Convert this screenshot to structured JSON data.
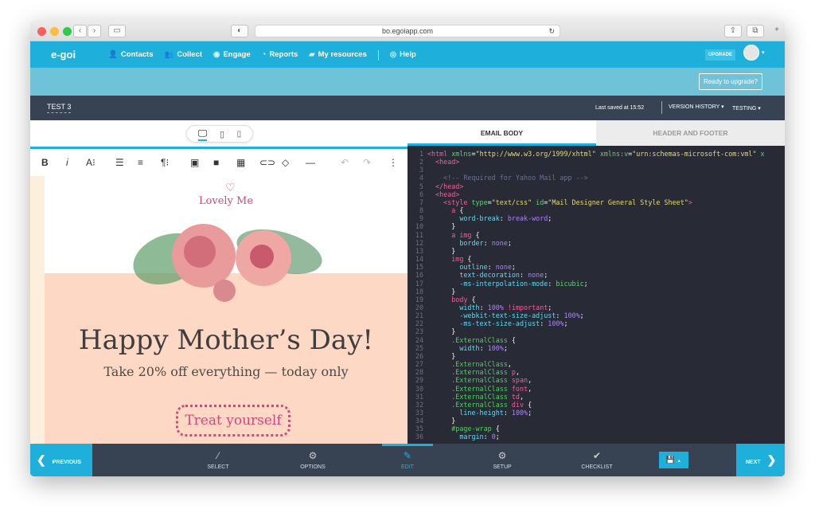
{
  "browser": {
    "url": "bo.egoiapp.com"
  },
  "nav": {
    "logo": "e-goi",
    "items": [
      {
        "icon": "contacts-icon",
        "glyph": "👤",
        "label": "Contacts"
      },
      {
        "icon": "collect-icon",
        "glyph": "👥",
        "label": "Collect"
      },
      {
        "icon": "engage-icon",
        "glyph": "◉",
        "label": "Engage"
      },
      {
        "icon": "reports-icon",
        "glyph": "◔",
        "label": "Reports"
      },
      {
        "icon": "folder-icon",
        "glyph": "▰",
        "label": "My resources"
      }
    ],
    "help": "Help",
    "upgrade": "UPGRADE"
  },
  "banner": {
    "ready": "Ready to upgrade?"
  },
  "editorbar": {
    "name": "TEST 3",
    "saved": "Last saved at 15:52",
    "version_history": "VERSION HISTORY ▾",
    "testing": "TESTING ▾"
  },
  "email": {
    "brand": "Lovely Me",
    "headline": "Happy Mother’s Day!",
    "subline": "Take 20% off everything — today only",
    "cta": "Treat yourself"
  },
  "tabs": {
    "email_body": "EMAIL BODY",
    "header_footer": "HEADER AND FOOTER"
  },
  "code": [
    [
      [
        "t-tag",
        "<html "
      ],
      [
        "t-attr",
        "xmlns"
      ],
      [
        "t-p",
        "="
      ],
      [
        "t-str",
        "\"http://www.w3.org/1999/xhtml\""
      ],
      [
        "t-p",
        " "
      ],
      [
        "t-attr",
        "xmlns:v"
      ],
      [
        "t-p",
        "="
      ],
      [
        "t-str",
        "\"urn:schemas-microsoft-com:vml\""
      ],
      [
        "t-attr",
        " x"
      ]
    ],
    [
      [
        "t-tag",
        "  <head>"
      ]
    ],
    [],
    [
      [
        "t-com",
        "    <!-- Required for Yahoo Mail app -->"
      ]
    ],
    [
      [
        "t-tag",
        "  </head>"
      ]
    ],
    [
      [
        "t-tag",
        "  <head>"
      ]
    ],
    [
      [
        "t-tag",
        "    <style "
      ],
      [
        "t-attr",
        "type"
      ],
      [
        "t-p",
        "="
      ],
      [
        "t-str",
        "\"text/css\""
      ],
      [
        "t-p",
        " "
      ],
      [
        "t-attr",
        "id"
      ],
      [
        "t-p",
        "="
      ],
      [
        "t-str",
        "\"Mail Designer General Style Sheet\""
      ],
      [
        "t-tag",
        ">"
      ]
    ],
    [
      [
        "t-tag",
        "      a"
      ],
      [
        "t-p",
        " {"
      ]
    ],
    [
      [
        "t-prop",
        "        word-break"
      ],
      [
        "t-p",
        ": "
      ],
      [
        "t-val",
        "break-word"
      ],
      [
        "t-p",
        ";"
      ]
    ],
    [
      [
        "t-p",
        "      }"
      ]
    ],
    [
      [
        "t-tag",
        "      a img"
      ],
      [
        "t-p",
        " {"
      ]
    ],
    [
      [
        "t-prop",
        "        border"
      ],
      [
        "t-p",
        ": "
      ],
      [
        "t-val",
        "none"
      ],
      [
        "t-p",
        ";"
      ]
    ],
    [
      [
        "t-p",
        "      }"
      ]
    ],
    [
      [
        "t-tag",
        "      img"
      ],
      [
        "t-p",
        " {"
      ]
    ],
    [
      [
        "t-prop",
        "        outline"
      ],
      [
        "t-p",
        ": "
      ],
      [
        "t-val",
        "none"
      ],
      [
        "t-p",
        ";"
      ]
    ],
    [
      [
        "t-prop",
        "        text-decoration"
      ],
      [
        "t-p",
        ": "
      ],
      [
        "t-val",
        "none"
      ],
      [
        "t-p",
        ";"
      ]
    ],
    [
      [
        "t-prop",
        "        -ms-interpolation-mode"
      ],
      [
        "t-p",
        ": "
      ],
      [
        "t-attr",
        "bicubic"
      ],
      [
        "t-p",
        ";"
      ]
    ],
    [
      [
        "t-p",
        "      }"
      ]
    ],
    [
      [
        "t-tag",
        "      body"
      ],
      [
        "t-p",
        " {"
      ]
    ],
    [
      [
        "t-prop",
        "        width"
      ],
      [
        "t-p",
        ": "
      ],
      [
        "t-val",
        "100%"
      ],
      [
        "t-tag",
        " !important"
      ],
      [
        "t-p",
        ";"
      ]
    ],
    [
      [
        "t-prop",
        "        -webkit-text-size-adjust"
      ],
      [
        "t-p",
        ": "
      ],
      [
        "t-val",
        "100%"
      ],
      [
        "t-p",
        ";"
      ]
    ],
    [
      [
        "t-prop",
        "        -ms-text-size-adjust"
      ],
      [
        "t-p",
        ": "
      ],
      [
        "t-val",
        "100%"
      ],
      [
        "t-p",
        ";"
      ]
    ],
    [
      [
        "t-p",
        "      }"
      ]
    ],
    [
      [
        "t-sel",
        "      .ExternalClass"
      ],
      [
        "t-p",
        " {"
      ]
    ],
    [
      [
        "t-prop",
        "        width"
      ],
      [
        "t-p",
        ": "
      ],
      [
        "t-val",
        "100%"
      ],
      [
        "t-p",
        ";"
      ]
    ],
    [
      [
        "t-p",
        "      }"
      ]
    ],
    [
      [
        "t-sel",
        "      .ExternalClass"
      ],
      [
        "t-p",
        ","
      ]
    ],
    [
      [
        "t-sel",
        "      .ExternalClass "
      ],
      [
        "t-tag",
        "p"
      ],
      [
        "t-p",
        ","
      ]
    ],
    [
      [
        "t-sel",
        "      .ExternalClass "
      ],
      [
        "t-tag",
        "span"
      ],
      [
        "t-p",
        ","
      ]
    ],
    [
      [
        "t-sel",
        "      .ExternalClass "
      ],
      [
        "t-tag",
        "font"
      ],
      [
        "t-p",
        ","
      ]
    ],
    [
      [
        "t-sel",
        "      .ExternalClass "
      ],
      [
        "t-tag",
        "td"
      ],
      [
        "t-p",
        ","
      ]
    ],
    [
      [
        "t-sel",
        "      .ExternalClass "
      ],
      [
        "t-tag",
        "div"
      ],
      [
        "t-p",
        " {"
      ]
    ],
    [
      [
        "t-prop",
        "        line-height"
      ],
      [
        "t-p",
        ": "
      ],
      [
        "t-val",
        "100%"
      ],
      [
        "t-p",
        ";"
      ]
    ],
    [
      [
        "t-p",
        "      }"
      ]
    ],
    [
      [
        "t-sel",
        "      #page-wrap"
      ],
      [
        "t-p",
        " {"
      ]
    ],
    [
      [
        "t-prop",
        "        margin"
      ],
      [
        "t-p",
        ": "
      ],
      [
        "t-val",
        "0"
      ],
      [
        "t-p",
        ";"
      ]
    ]
  ],
  "bottom": {
    "previous": "PREVIOUS",
    "next": "NEXT",
    "steps": [
      {
        "label": "SELECT",
        "icon": "wand-icon",
        "glyph": "⁄"
      },
      {
        "label": "OPTIONS",
        "icon": "gear-icon",
        "glyph": "⚙"
      },
      {
        "label": "EDIT",
        "icon": "pencil-icon",
        "glyph": "✎",
        "active": true
      },
      {
        "label": "SETUP",
        "icon": "gears-icon",
        "glyph": "⚙"
      },
      {
        "label": "CHECKLIST",
        "icon": "check-icon",
        "glyph": "✔"
      }
    ]
  },
  "colors": {
    "accent": "#1eb0db",
    "dark": "#374352",
    "code_bg": "#282a36",
    "brand_pink": "#d4477a",
    "email_bg": "#fdd8c5"
  }
}
